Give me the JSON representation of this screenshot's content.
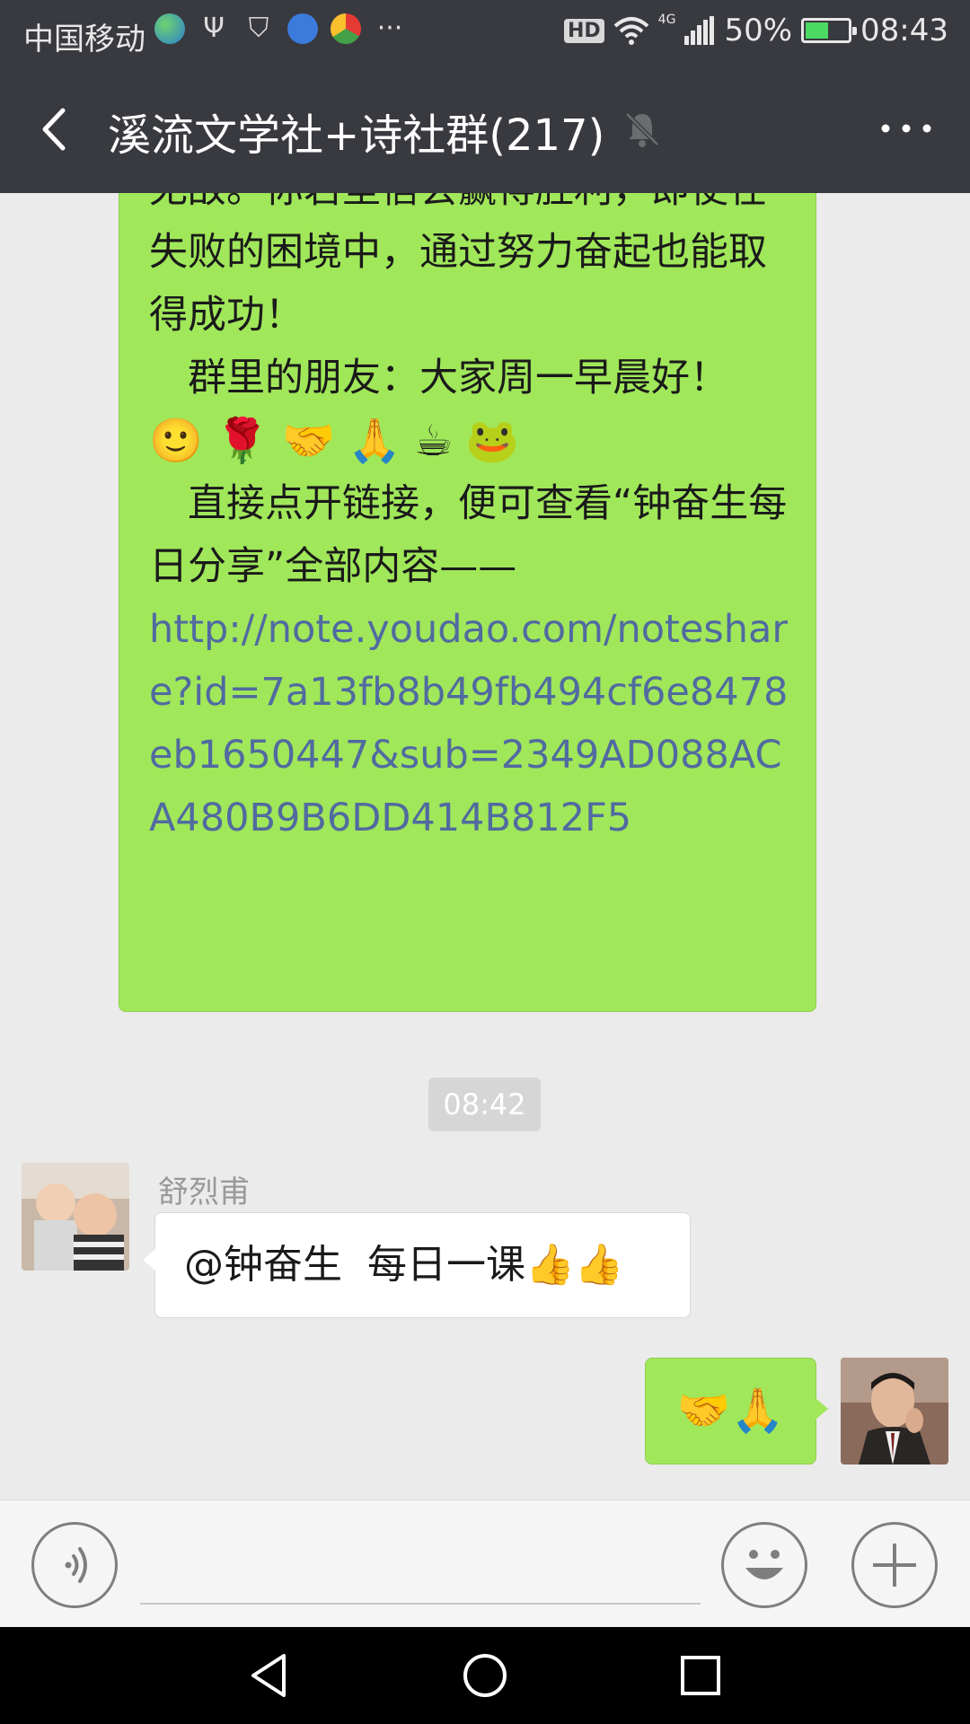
{
  "status_bar": {
    "carrier": "中国移动",
    "hd": "HD",
    "network": "4G",
    "battery": "50%",
    "battery_level": 0.5,
    "time": "08:43",
    "more": "···"
  },
  "header": {
    "title": "溪流文学社+诗社群(217)",
    "back_icon": "back-arrow-icon",
    "mute_icon": "bell-muted-icon",
    "more_icon": "more-dots-icon"
  },
  "messages": {
    "long_message": {
      "line1": "无敌。你若坚信会赢得胜利，即使在失败的困境中，通过努力奋起也能取得成功！",
      "line2": "　群里的朋友：大家周一早晨好！",
      "emoji_row": [
        "🙂",
        "🌹",
        "🤝",
        "🙏",
        "☕",
        "🐸"
      ],
      "line3": "　直接点开链接，便可查看“钟奋生每日分享”全部内容——",
      "link": "http://note.youdao.com/noteshare?id=7a13fb8b49fb494cf6e8478eb1650447&sub=2349AD088ACA480B9B6DD414B812F5"
    },
    "timestamp": "08:42",
    "incoming": {
      "sender": "舒烈甫",
      "text": "@钟奋生  每日一课👍👍"
    },
    "outgoing": {
      "text": "🤝🙏"
    }
  },
  "input_bar": {
    "voice_icon": "voice-icon",
    "emoji_icon": "smiley-icon",
    "plus_icon": "plus-icon",
    "placeholder": ""
  },
  "colors": {
    "header_bg": "#393a3f",
    "chat_bg": "#ebebeb",
    "bubble_green": "#a0e75a",
    "link": "#516aa0"
  }
}
